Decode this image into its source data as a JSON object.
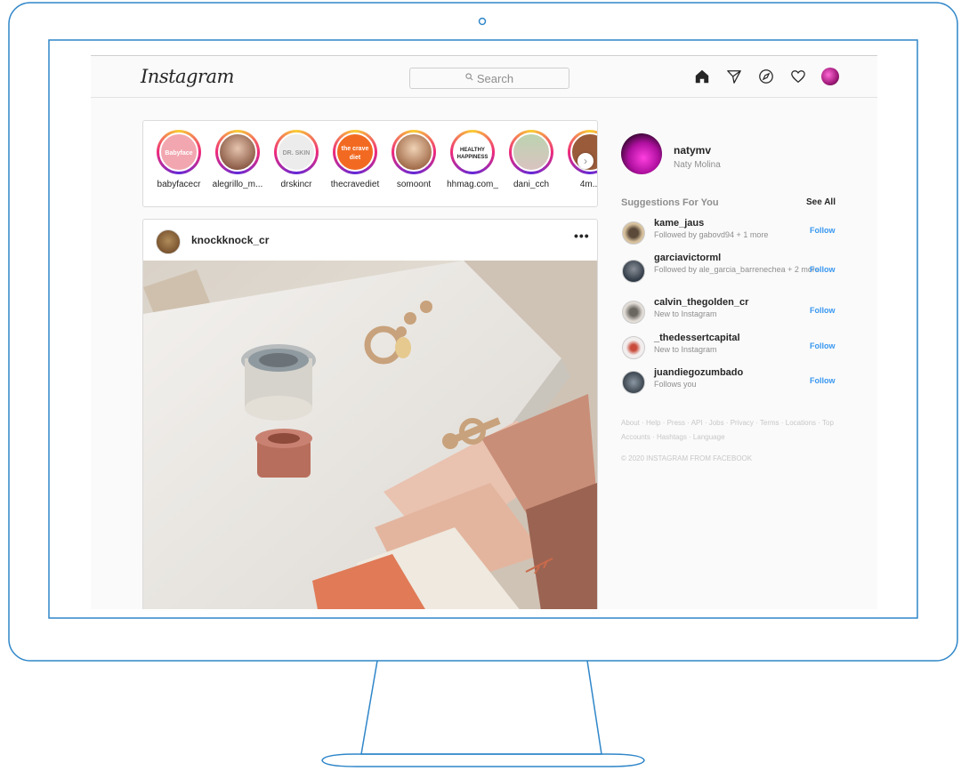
{
  "header": {
    "logo": "Instagram",
    "search_placeholder": "Search"
  },
  "nav_icons": [
    "home-icon",
    "direct-message-icon",
    "explore-compass-icon",
    "activity-heart-icon",
    "profile-avatar"
  ],
  "stories": [
    {
      "username": "babyfacecr",
      "image_text": "Babyface",
      "color": "#f2a7b0"
    },
    {
      "username": "alegrillo_m...",
      "image_text": "",
      "color": "#c9a089"
    },
    {
      "username": "drskincr",
      "image_text": "DR. SKIN",
      "color": "#ececec"
    },
    {
      "username": "thecravediet",
      "image_text": "the crave diet",
      "color": "#f26a21"
    },
    {
      "username": "somoont",
      "image_text": "",
      "color": "#d9b48f"
    },
    {
      "username": "hhmag.com_",
      "image_text": "HEALTHY HAPPINESS",
      "color": "#ffffff"
    },
    {
      "username": "dani_cch",
      "image_text": "",
      "color": "#bcd3b0"
    },
    {
      "username": "4m...",
      "image_text": "",
      "color": "#9a5b3a"
    }
  ],
  "post": {
    "username": "knockknock_cr",
    "more_label": "•••"
  },
  "sidebar": {
    "username": "natymv",
    "name": "Naty Molina",
    "suggestions_title": "Suggestions For You",
    "see_all": "See All",
    "suggestions": [
      {
        "username": "kame_jaus",
        "desc": "Followed by gabovd94 + 1 more",
        "follow": "Follow"
      },
      {
        "username": "garciavictorml",
        "desc": "Followed by ale_garcia_barrenechea + 2 more",
        "follow": "Follow"
      },
      {
        "username": "calvin_thegolden_cr",
        "desc": "New to Instagram",
        "follow": "Follow"
      },
      {
        "username": "_thedessertcapital",
        "desc": "New to Instagram",
        "follow": "Follow"
      },
      {
        "username": "juandiegozumbado",
        "desc": "Follows you",
        "follow": "Follow"
      }
    ],
    "footer_links": "About · Help · Press · API · Jobs · Privacy · Terms · Locations · Top Accounts · Hashtags · Language",
    "copyright": "© 2020 INSTAGRAM FROM FACEBOOK"
  },
  "colors": {
    "frame": "#2f86c9",
    "link": "#3897f0",
    "text": "#262626",
    "muted": "#8e8e8e"
  }
}
